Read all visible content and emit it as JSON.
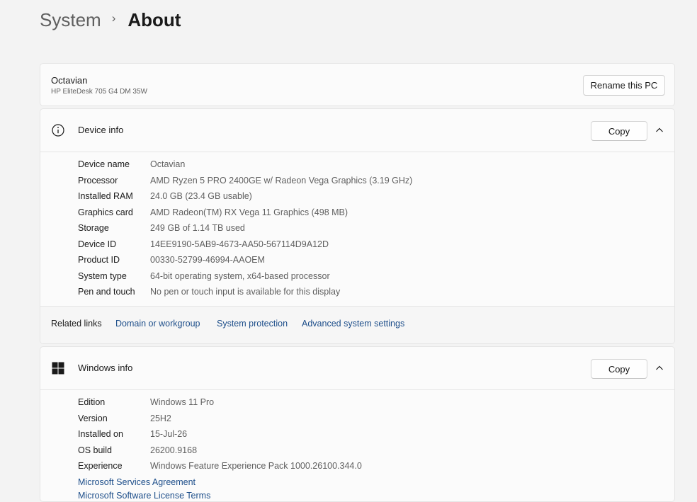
{
  "breadcrumb": {
    "parent": "System",
    "separator": "›",
    "current": "About"
  },
  "pc": {
    "name": "Octavian",
    "model": "HP EliteDesk 705 G4 DM 35W",
    "rename_label": "Rename this PC"
  },
  "device_info": {
    "title": "Device info",
    "copy_label": "Copy",
    "specs": [
      {
        "label": "Device name",
        "value": "Octavian"
      },
      {
        "label": "Processor",
        "value": "AMD Ryzen 5 PRO 2400GE w/ Radeon Vega Graphics (3.19 GHz)"
      },
      {
        "label": "Installed RAM",
        "value": "24.0 GB (23.4 GB usable)"
      },
      {
        "label": "Graphics card",
        "value": "AMD Radeon(TM) RX Vega 11 Graphics (498 MB)"
      },
      {
        "label": "Storage",
        "value": "249 GB of 1.14 TB used"
      },
      {
        "label": "Device ID",
        "value": "14EE9190-5AB9-4673-AA50-567114D9A12D"
      },
      {
        "label": "Product ID",
        "value": "00330-52799-46994-AAOEM"
      },
      {
        "label": "System type",
        "value": "64-bit operating system, x64-based processor"
      },
      {
        "label": "Pen and touch",
        "value": "No pen or touch input is available for this display"
      }
    ]
  },
  "related_links": {
    "label": "Related links",
    "links": [
      "Domain or workgroup",
      "System protection",
      "Advanced system settings"
    ]
  },
  "windows_info": {
    "title": "Windows info",
    "copy_label": "Copy",
    "specs": [
      {
        "label": "Edition",
        "value": "Windows 11 Pro"
      },
      {
        "label": "Version",
        "value": "25H2"
      },
      {
        "label": "Installed on",
        "value": "15-Jul-26"
      },
      {
        "label": "OS build",
        "value": "26200.9168"
      },
      {
        "label": "Experience",
        "value": "Windows Feature Experience Pack 1000.26100.344.0"
      }
    ],
    "links": [
      "Microsoft Services Agreement",
      "Microsoft Software License Terms"
    ]
  },
  "colors": {
    "link": "#1d4e8a",
    "accent_logo": "#1a1a1a"
  }
}
